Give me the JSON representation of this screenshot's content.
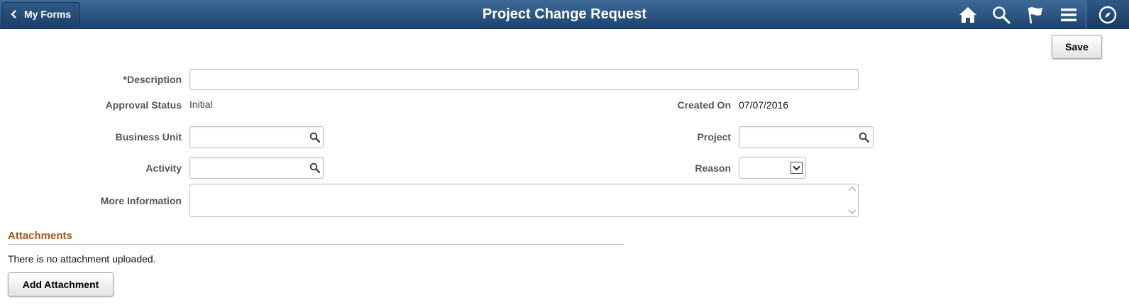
{
  "banner": {
    "back_label": "My Forms",
    "title": "Project Change Request",
    "icons": [
      "home-icon",
      "search-icon",
      "flag-icon",
      "menu-icon",
      "navbar-compass-icon"
    ]
  },
  "toolbar": {
    "save_label": "Save"
  },
  "form": {
    "description_label": "*Description",
    "description_value": "",
    "approval_status_label": "Approval Status",
    "approval_status_value": "Initial",
    "created_on_label": "Created On",
    "created_on_value": "07/07/2016",
    "business_unit_label": "Business Unit",
    "business_unit_value": "",
    "project_label": "Project",
    "project_value": "",
    "activity_label": "Activity",
    "activity_value": "",
    "reason_label": "Reason",
    "reason_value": "",
    "more_info_label": "More Information",
    "more_info_value": ""
  },
  "attachments": {
    "title": "Attachments",
    "empty_text": "There is no attachment uploaded.",
    "add_label": "Add Attachment"
  },
  "colors": {
    "banner_top": "#3e6a97",
    "banner_bottom": "#1d4370",
    "section_title": "#a6561d"
  }
}
